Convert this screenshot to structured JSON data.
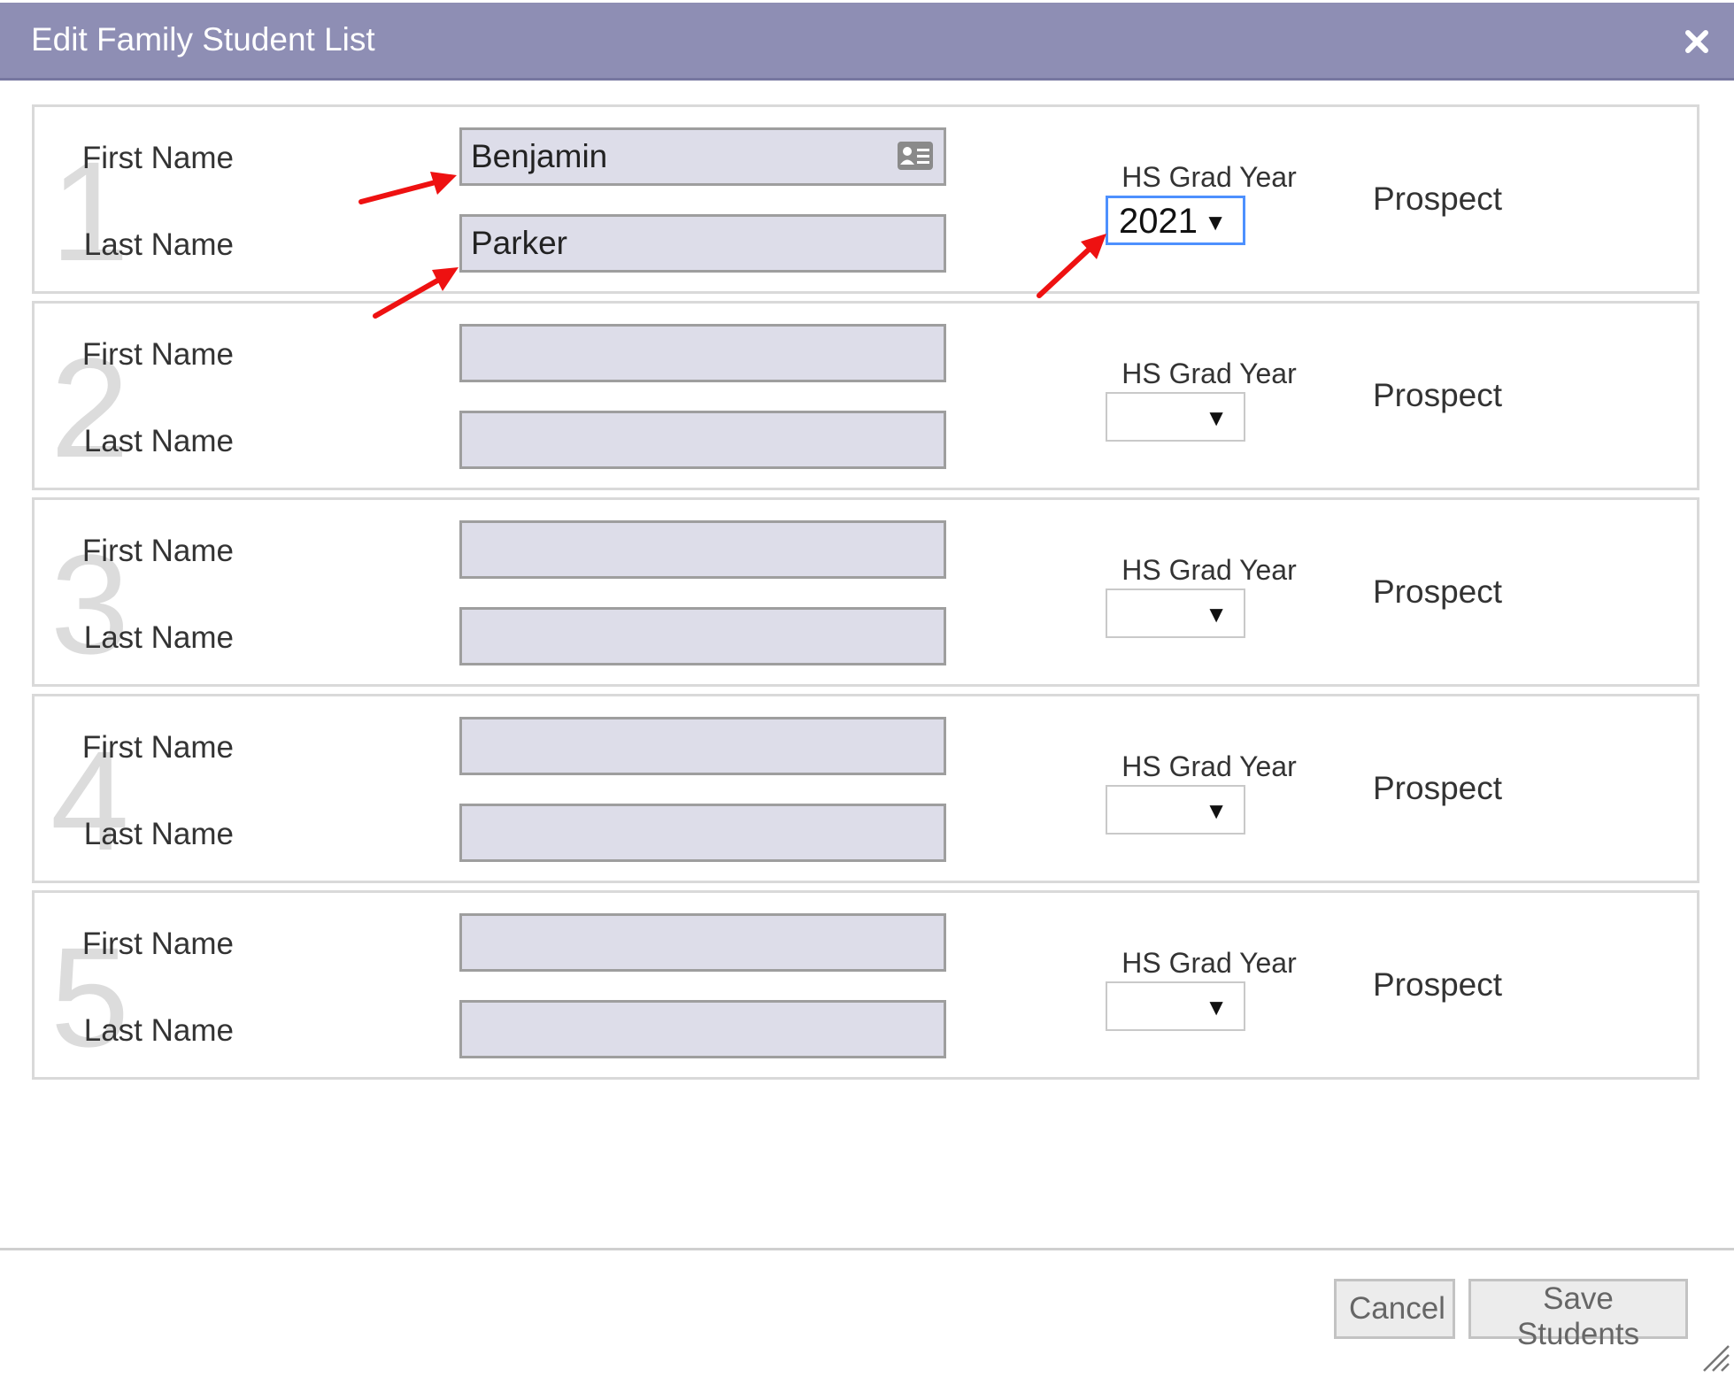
{
  "dialog": {
    "title": "Edit Family Student List",
    "close_icon": "close-icon",
    "header_color": "#8e8eb4"
  },
  "labels": {
    "first_name": "First Name",
    "last_name": "Last Name",
    "grad_year": "HS Grad Year",
    "status": "Prospect"
  },
  "students": [
    {
      "number": "1",
      "first_name": "Benjamin",
      "last_name": "Parker",
      "grad_year": "2021",
      "status": "Prospect"
    },
    {
      "number": "2",
      "first_name": "",
      "last_name": "",
      "grad_year": "",
      "status": "Prospect"
    },
    {
      "number": "3",
      "first_name": "",
      "last_name": "",
      "grad_year": "",
      "status": "Prospect"
    },
    {
      "number": "4",
      "first_name": "",
      "last_name": "",
      "grad_year": "",
      "status": "Prospect"
    },
    {
      "number": "5",
      "first_name": "",
      "last_name": "",
      "grad_year": "",
      "status": "Prospect"
    }
  ],
  "footer": {
    "cancel_label": "Cancel",
    "save_label": "Save Students"
  },
  "icons": {
    "contact_card": "contact-card-icon",
    "dropdown": "chevron-down-icon",
    "annotation": "red-arrow-icon",
    "resize": "resize-grip-icon"
  },
  "colors": {
    "input_bg": "#dddde9",
    "focus_border": "#4d90fe",
    "annotation_arrow": "#ee1111"
  }
}
